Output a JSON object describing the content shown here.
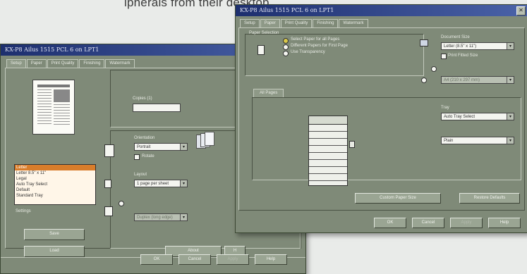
{
  "background_text": "ipherals from their desktop.",
  "colors": {
    "titlebar": "#1d2f6e",
    "window": "#7f8a78",
    "selection": "#d87d2b"
  },
  "left": {
    "title": "KX-P8 Ailus 1515 PCL 6 on LPT1",
    "tabs": [
      "Setup",
      "Paper",
      "Print Quality",
      "Finishing",
      "Watermark"
    ],
    "copies_label": "Copies (1)",
    "copies_value": "",
    "orientation_label": "Orientation",
    "orientation_value": "Portrait",
    "rotate_label": "Rotate",
    "layout_label": "Layout",
    "layout_value": "1 page per sheet",
    "duplex_value": "Duplex (long edge)",
    "paper_list": [
      "Letter",
      "Letter 8.5\" x 11\"",
      "Legal",
      "Auto Tray Select",
      "Default",
      "Standard Tray"
    ],
    "settings_label": "Settings",
    "save_button": "Save",
    "load_button": "Load",
    "about_button": "About",
    "help_stub": "H",
    "ok_button": "OK",
    "cancel_button": "Cancel",
    "apply_button": "Apply",
    "help_button": "Help"
  },
  "right": {
    "title": "KX-P8 Ailus 1515 PCL 6 on LPT1",
    "tabs": [
      "Setup",
      "Paper",
      "Print Quality",
      "Finishing",
      "Watermark"
    ],
    "paper_selection_label": "Paper Selection",
    "options": [
      "Select Paper for all Pages",
      "Different Papers for First Page",
      "Use Transparency"
    ],
    "document_size_label": "Document Size",
    "document_size_value": "Letter (8.5\" x 11\")",
    "print_fitted_label": "Print Fitted Size",
    "output_value": "A4 (210 x 297 mm)",
    "all_pages_tab": "All Pages",
    "tray_label": "Tray",
    "tray_value": "Auto Tray Select",
    "type_value": "Plain",
    "custom_paper_button": "Custom Paper Size",
    "restore_button": "Restore Defaults",
    "ok_button": "OK",
    "cancel_button": "Cancel",
    "apply_button": "Apply",
    "help_button": "Help"
  }
}
